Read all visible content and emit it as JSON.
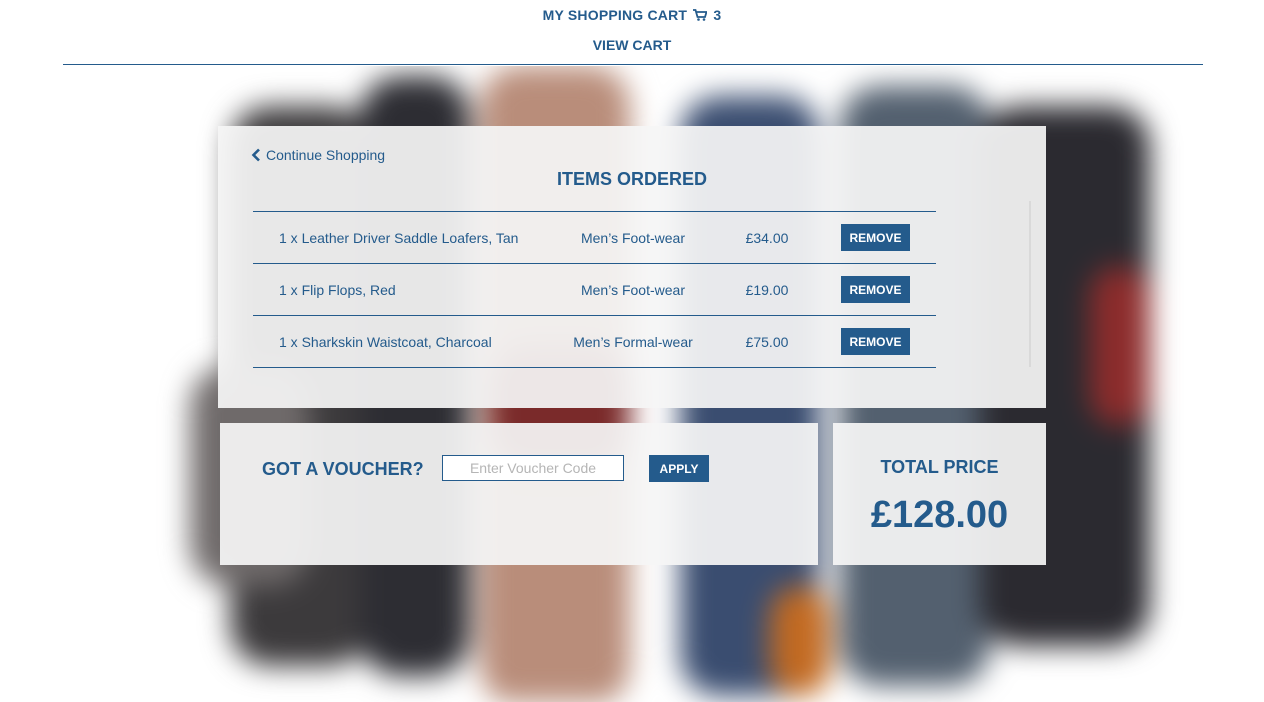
{
  "header": {
    "cart_title": "MY SHOPPING CART",
    "cart_count": "3",
    "cart_icon": "shopping-cart-icon",
    "view_cart_label": "VIEW CART"
  },
  "items_panel": {
    "continue_label": "Continue Shopping",
    "continue_icon": "chevron-left-icon",
    "title": "ITEMS ORDERED",
    "items": [
      {
        "name": "1 x Leather Driver Saddle Loafers, Tan",
        "category": "Men’s Foot-wear",
        "price": "£34.00",
        "action": "REMOVE"
      },
      {
        "name": "1 x Flip Flops, Red",
        "category": "Men’s Foot-wear",
        "price": "£19.00",
        "action": "REMOVE"
      },
      {
        "name": "1 x Sharkskin Waistcoat, Charcoal",
        "category": "Men’s Formal-wear",
        "price": "£75.00",
        "action": "REMOVE"
      }
    ]
  },
  "voucher": {
    "label": "GOT A VOUCHER?",
    "placeholder": "Enter Voucher Code",
    "value": "",
    "apply_label": "APPLY"
  },
  "total": {
    "label": "TOTAL PRICE",
    "value": "£128.00"
  },
  "colors": {
    "accent": "#245b8c",
    "panel": "#f5f5f5",
    "button_text": "#ffffff"
  }
}
